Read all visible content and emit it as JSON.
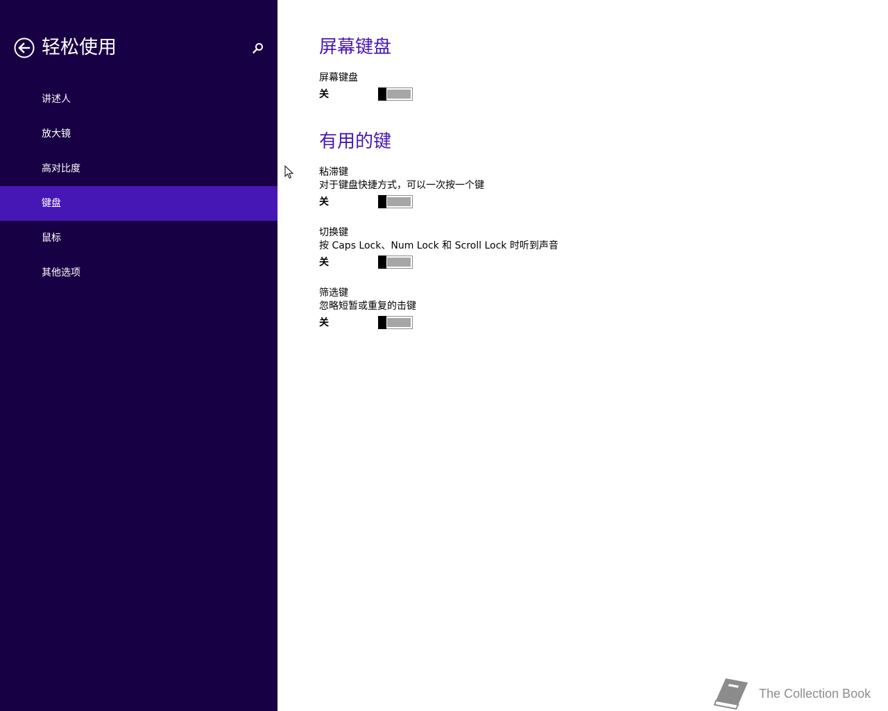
{
  "sidebar": {
    "title": "轻松使用",
    "back_icon": "back-arrow-icon",
    "search_icon": "search-icon",
    "background_color": "#180044",
    "selected_color": "#4617b4",
    "items": [
      {
        "label": "讲述人",
        "selected": false
      },
      {
        "label": "放大镜",
        "selected": false
      },
      {
        "label": "高对比度",
        "selected": false
      },
      {
        "label": "键盘",
        "selected": true
      },
      {
        "label": "鼠标",
        "selected": false
      },
      {
        "label": "其他选项",
        "selected": false
      }
    ]
  },
  "main": {
    "accent_color": "#4617b4",
    "sections": [
      {
        "heading": "屏幕键盘",
        "settings": [
          {
            "label": "屏幕键盘",
            "description": "",
            "state": "关",
            "on": false
          }
        ]
      },
      {
        "heading": "有用的键",
        "settings": [
          {
            "label": "粘滞键",
            "description": "对于键盘快捷方式，可以一次按一个键",
            "state": "关",
            "on": false
          },
          {
            "label": "切换键",
            "description": "按 Caps Lock、Num Lock 和 Scroll Lock 时听到声音",
            "state": "关",
            "on": false
          },
          {
            "label": "筛选键",
            "description": "忽略短暂或重复的击键",
            "state": "关",
            "on": false
          }
        ]
      }
    ]
  },
  "watermark": {
    "text": "The Collection Book",
    "icon": "book-icon"
  }
}
